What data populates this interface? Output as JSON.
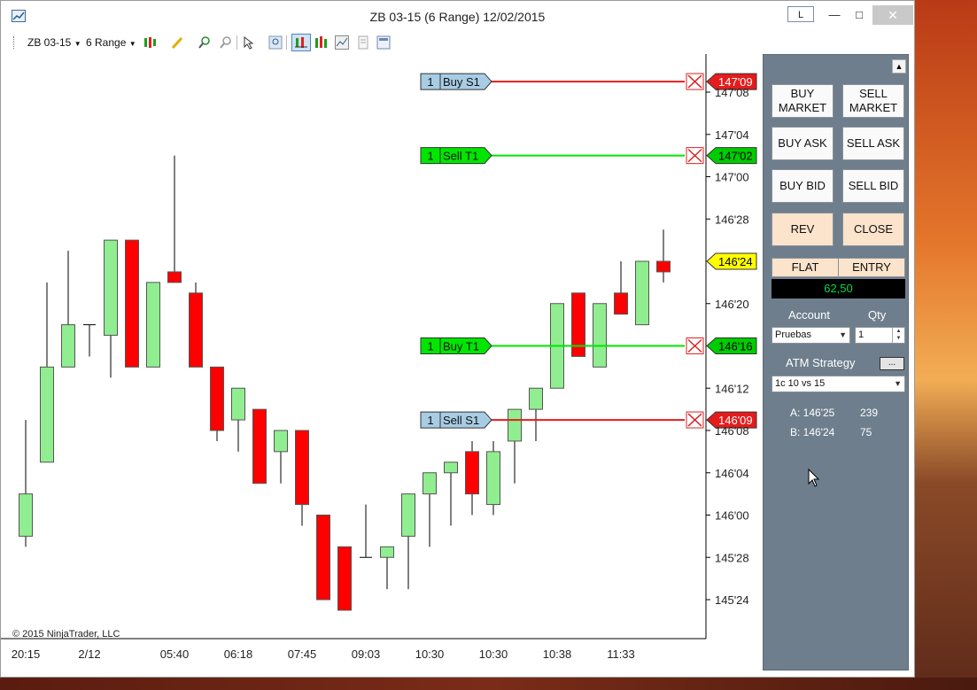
{
  "window": {
    "title": "ZB 03-15 (6 Range)  12/02/2015",
    "layout_button": "L",
    "min_icon": "—",
    "max_icon": "□",
    "close_icon": "✕"
  },
  "toolbar": {
    "instrument": "ZB 03-15",
    "period": "6 Range",
    "icons": [
      "candlestick-style-icon",
      "pencil-draw-icon",
      "zoom-in-icon",
      "zoom-out-icon",
      "pointer-icon",
      "magnifier-icon",
      "chart-trader-icon",
      "bar-style-icon",
      "indicators-icon",
      "strategies-icon",
      "properties-icon"
    ]
  },
  "chart": {
    "copyright": "© 2015 NinjaTrader, LLC",
    "price_labels": [
      "147'08",
      "147'04",
      "147'00",
      "146'28",
      "146'20",
      "146'12",
      "146'08",
      "146'04",
      "146'00",
      "145'28",
      "145'24"
    ],
    "time_labels": [
      "20:15",
      "2/12",
      "05:40",
      "06:18",
      "07:45",
      "09:03",
      "10:30",
      "10:30",
      "10:38",
      "11:33"
    ],
    "orders": [
      {
        "qty": "1",
        "label": "Buy S1",
        "price": "147'09",
        "kind": "stop"
      },
      {
        "qty": "1",
        "label": "Sell T1",
        "price": "147'02",
        "kind": "target"
      },
      {
        "qty": "1",
        "label": "Buy T1",
        "price": "146'16",
        "kind": "target"
      },
      {
        "qty": "1",
        "label": "Sell S1",
        "price": "146'09",
        "kind": "stop"
      }
    ],
    "last_price": "146'24",
    "colors": {
      "up": "#90ee90",
      "down": "#ff0000",
      "stop": "#e51c1c",
      "target": "#00e600",
      "stop_tag": "#a8cce4",
      "last": "#ffff00"
    },
    "candles": [
      {
        "o": "145'30",
        "h": "146'09",
        "l": "145'29",
        "c": "146'02"
      },
      {
        "o": "146'05",
        "h": "146'22",
        "l": "146'17",
        "c": "146'14"
      },
      {
        "o": "146'14",
        "h": "146'25",
        "l": "146'17",
        "c": "146'18"
      },
      {
        "o": "146'18",
        "h": "146'18",
        "l": "146'15",
        "c": "146'18"
      },
      {
        "o": "146'17",
        "h": "146'18",
        "l": "146'13",
        "c": "146'26"
      },
      {
        "o": "146'26",
        "h": "146'18",
        "l": "146'17",
        "c": "146'14"
      },
      {
        "o": "146'14",
        "h": "146'18",
        "l": "146'20",
        "c": "146'22"
      },
      {
        "o": "146'23",
        "h": "147'02",
        "l": "146'24",
        "c": "146'22"
      },
      {
        "o": "146'21",
        "h": "146'22",
        "l": "146'16",
        "c": "146'14"
      },
      {
        "o": "146'14",
        "h": "146'08",
        "l": "146'07",
        "c": "146'08"
      },
      {
        "o": "146'09",
        "h": "146'09",
        "l": "146'06",
        "c": "146'12"
      },
      {
        "o": "146'10",
        "h": "146'09",
        "l": "146'06",
        "c": "146'03"
      },
      {
        "o": "146'06",
        "h": "146'06",
        "l": "146'03",
        "c": "146'08"
      },
      {
        "o": "146'08",
        "h": "146'01",
        "l": "145'31",
        "c": "146'01"
      },
      {
        "o": "146'00",
        "h": "145'31",
        "l": "145'27",
        "c": "145'24"
      },
      {
        "o": "145'29",
        "h": "145'29",
        "l": "145'24",
        "c": "145'23"
      },
      {
        "o": "145'28",
        "h": "146'01",
        "l": "145'29",
        "c": "145'28"
      },
      {
        "o": "145'28",
        "h": "145'29",
        "l": "145'25",
        "c": "145'29"
      },
      {
        "o": "145'30",
        "h": "145'28",
        "l": "145'25",
        "c": "146'02"
      },
      {
        "o": "146'02",
        "h": "146'03",
        "l": "145'29",
        "c": "146'04"
      },
      {
        "o": "146'04",
        "h": "146'04",
        "l": "145'31",
        "c": "146'05"
      },
      {
        "o": "146'06",
        "h": "146'07",
        "l": "146'00",
        "c": "146'02"
      },
      {
        "o": "146'01",
        "h": "146'07",
        "l": "146'00",
        "c": "146'06"
      },
      {
        "o": "146'07",
        "h": "146'09",
        "l": "146'03",
        "c": "146'10"
      },
      {
        "o": "146'10",
        "h": "146'12",
        "l": "146'07",
        "c": "146'12"
      },
      {
        "o": "146'12",
        "h": "146'20",
        "l": "146'12",
        "c": "146'20"
      },
      {
        "o": "146'21",
        "h": "146'21",
        "l": "146'15",
        "c": "146'15"
      },
      {
        "o": "146'14",
        "h": "146'20",
        "l": "146'14",
        "c": "146'20"
      },
      {
        "o": "146'21",
        "h": "146'24",
        "l": "146'19",
        "c": "146'19"
      },
      {
        "o": "146'18",
        "h": "146'23",
        "l": "146'18",
        "c": "146'24"
      },
      {
        "o": "146'24",
        "h": "146'27",
        "l": "146'22",
        "c": "146'23"
      }
    ]
  },
  "panel": {
    "buttons": [
      {
        "label": "BUY MARKET"
      },
      {
        "label": "SELL MARKET"
      },
      {
        "label": "BUY ASK"
      },
      {
        "label": "SELL ASK"
      },
      {
        "label": "BUY BID"
      },
      {
        "label": "SELL BID"
      },
      {
        "label": "REV"
      },
      {
        "label": "CLOSE"
      }
    ],
    "flat_label": "FLAT",
    "entry_label": "ENTRY",
    "pnl": "62,50",
    "account_label": "Account",
    "qty_label": "Qty",
    "account_value": "Pruebas",
    "qty_value": "1",
    "atm_label": "ATM Strategy",
    "atm_button": "...",
    "atm_value": "1c 10 vs 15",
    "ask_row": {
      "label": "A: 146'25",
      "size": "239"
    },
    "bid_row": {
      "label": "B: 146'24",
      "size": "75"
    }
  }
}
